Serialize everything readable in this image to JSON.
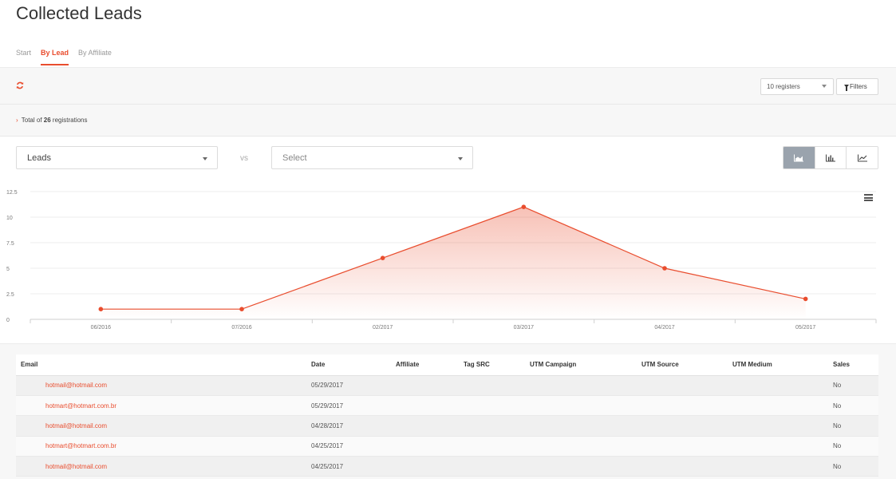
{
  "page_title": "Collected Leads",
  "tabs": [
    {
      "label": "Start",
      "active": false
    },
    {
      "label": "By Lead",
      "active": true
    },
    {
      "label": "By Affiliate",
      "active": false
    }
  ],
  "toolbar": {
    "refresh_icon": "refresh-icon",
    "registers_select": "10 registers",
    "filters_label": "Filters",
    "filter_icon": "funnel-icon"
  },
  "summary": {
    "prefix": "Total of",
    "count": "26",
    "suffix": "registrations"
  },
  "selectors": {
    "primary_metric": "Leads",
    "vs_label": "vs",
    "secondary_metric_placeholder": "Select"
  },
  "chart_type_buttons": [
    {
      "name": "area-chart-icon",
      "active": true
    },
    {
      "name": "bar-chart-icon",
      "active": false
    },
    {
      "name": "line-chart-icon",
      "active": false
    }
  ],
  "colors": {
    "accent": "#e94d2e",
    "active_button": "#9aa3ad"
  },
  "chart_data": {
    "type": "area",
    "categories": [
      "06/2016",
      "07/2016",
      "02/2017",
      "03/2017",
      "04/2017",
      "05/2017"
    ],
    "series": [
      {
        "values": [
          1,
          1,
          6,
          11,
          5,
          2
        ]
      }
    ],
    "y_ticks": [
      "0",
      "2.5",
      "5",
      "7.5",
      "10",
      "12.5"
    ],
    "ylim": [
      0,
      12.5
    ],
    "grid": true,
    "legend": "none"
  },
  "table": {
    "columns": [
      "Email",
      "Date",
      "Affiliate",
      "Tag SRC",
      "UTM Campaign",
      "UTM Source",
      "UTM Medium",
      "Sales"
    ],
    "rows": [
      {
        "email": "hotmail@hotmail.com",
        "date": "05/29/2017",
        "affiliate": "",
        "tag_src": "",
        "utm_campaign": "",
        "utm_source": "",
        "utm_medium": "",
        "sales": "No"
      },
      {
        "email": "hotmart@hotmart.com.br",
        "date": "05/29/2017",
        "affiliate": "",
        "tag_src": "",
        "utm_campaign": "",
        "utm_source": "",
        "utm_medium": "",
        "sales": "No"
      },
      {
        "email": "hotmail@hotmail.com",
        "date": "04/28/2017",
        "affiliate": "",
        "tag_src": "",
        "utm_campaign": "",
        "utm_source": "",
        "utm_medium": "",
        "sales": "No"
      },
      {
        "email": "hotmart@hotmart.com.br",
        "date": "04/25/2017",
        "affiliate": "",
        "tag_src": "",
        "utm_campaign": "",
        "utm_source": "",
        "utm_medium": "",
        "sales": "No"
      },
      {
        "email": "hotmail@hotmail.com",
        "date": "04/25/2017",
        "affiliate": "",
        "tag_src": "",
        "utm_campaign": "",
        "utm_source": "",
        "utm_medium": "",
        "sales": "No"
      }
    ]
  }
}
